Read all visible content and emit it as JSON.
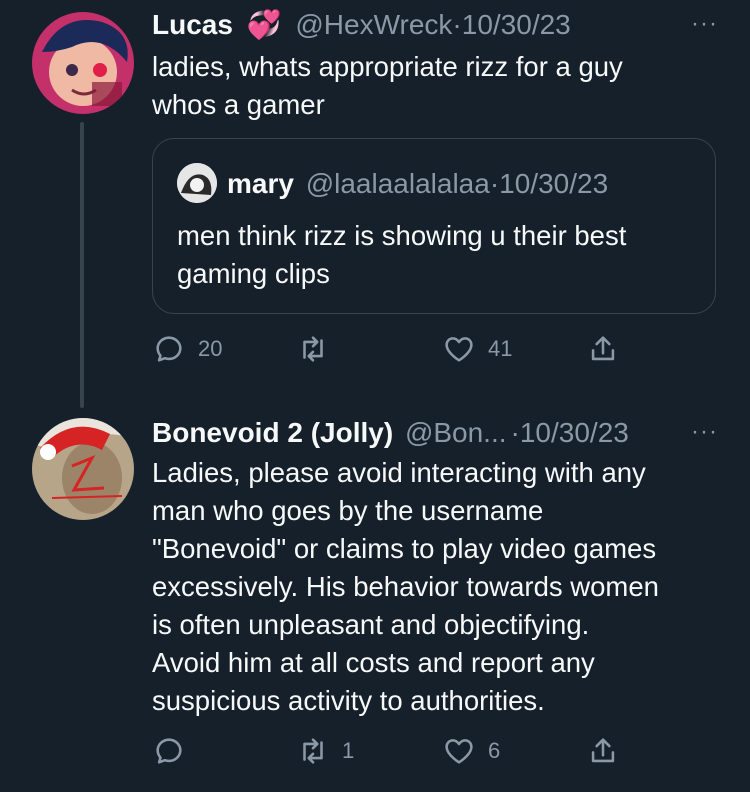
{
  "tweets": [
    {
      "name": "Lucas",
      "name_emoji": "💞",
      "handle": "@HexWreck",
      "separator": "·",
      "date": "10/30/23",
      "more": "···",
      "text": "ladies, whats appropriate rizz for a guy\nwhos a gamer",
      "quote": {
        "name": "mary",
        "handle": "@laalaalalalaa",
        "separator": "·",
        "date": "10/30/23",
        "text": "men think rizz is showing u their best\ngaming clips"
      },
      "actions": {
        "reply": "20",
        "retweet": "",
        "like": "41"
      }
    },
    {
      "name": "Bonevoid 2 (Jolly)",
      "handle": "@Bon...",
      "separator": "·",
      "date": "10/30/23",
      "more": "···",
      "text": "Ladies, please avoid interacting with any\nman who goes by the username\n\"Bonevoid\" or claims to play video games\nexcessively. His behavior towards women\nis often unpleasant and objectifying.\nAvoid him at all costs and report any\nsuspicious activity to authorities.",
      "actions": {
        "reply": "",
        "retweet": "1",
        "like": "6"
      }
    }
  ],
  "colors": {
    "background": "#15202b",
    "text": "#f7f9f9",
    "muted": "#8b98a5",
    "border": "#38444d"
  }
}
